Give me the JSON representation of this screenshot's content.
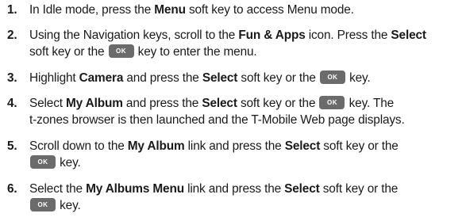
{
  "ok_key_label": "OK",
  "steps": [
    {
      "number": "1.",
      "t1": "In Idle mode, press the ",
      "b1": "Menu",
      "t2": " soft key to access Menu mode."
    },
    {
      "number": "2.",
      "line1_t1": "Using the Navigation keys, scroll to the ",
      "line1_b1": "Fun & Apps",
      "line1_t2": " icon. Press the ",
      "line1_b2": "Select",
      "line2_t1": "soft key or the ",
      "line2_t2": " key to enter the menu."
    },
    {
      "number": "3.",
      "t1": "Highlight ",
      "b1": "Camera",
      "t2": " and press the ",
      "b2": "Select",
      "t3": " soft key or the ",
      "t4": " key."
    },
    {
      "number": "4.",
      "line1_t1": "Select ",
      "line1_b1": "My Album",
      "line1_t2": " and press the ",
      "line1_b2": "Select",
      "line1_t3": " soft key or the ",
      "line1_t4": " key. The",
      "line2_t1": "t-zones browser is then launched and the T-Mobile Web page displays."
    },
    {
      "number": "5.",
      "line1_t1": "Scroll down to the ",
      "line1_b1": "My Album",
      "line1_t2": " link and press the ",
      "line1_b2": "Select",
      "line1_t3": " soft key or the",
      "line2_t1": " key."
    },
    {
      "number": "6.",
      "line1_t1": "Select the ",
      "line1_b1": "My Albums Menu",
      "line1_t2": " link and press the ",
      "line1_b2": "Select",
      "line1_t3": " soft key or the",
      "line2_t1": " key."
    }
  ]
}
